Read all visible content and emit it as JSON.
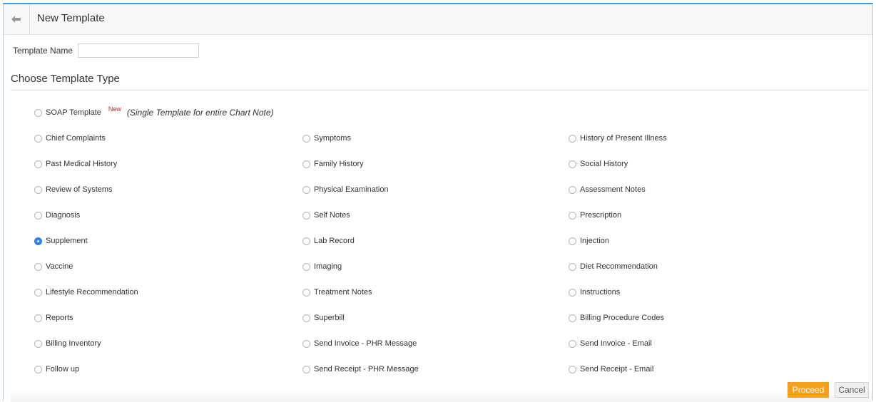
{
  "header": {
    "title": "New Template",
    "back_icon": "arrow-left-icon"
  },
  "template_name": {
    "label": "Template Name",
    "value": "",
    "placeholder": ""
  },
  "section": {
    "title": "Choose Template Type"
  },
  "soap": {
    "label": "SOAP Template",
    "badge": "New",
    "description": "(Single Template for entire Chart Note)",
    "selected": false
  },
  "selected_option": "Supplement",
  "accent_color": "#2f7fe5",
  "rows": [
    [
      "Chief Complaints",
      "Symptoms",
      "History of Present Illness"
    ],
    [
      "Past Medical History",
      "Family History",
      "Social History"
    ],
    [
      "Review of Systems",
      "Physical Examination",
      "Assessment Notes"
    ],
    [
      "Diagnosis",
      "Self Notes",
      "Prescription"
    ],
    [
      "Supplement",
      "Lab Record",
      "Injection"
    ],
    [
      "Vaccine",
      "Imaging",
      "Diet Recommendation"
    ],
    [
      "Lifestyle Recommendation",
      "Treatment Notes",
      "Instructions"
    ],
    [
      "Reports",
      "Superbill",
      "Billing Procedure Codes"
    ],
    [
      "Billing Inventory",
      "Send Invoice - PHR Message",
      "Send Invoice - Email"
    ],
    [
      "Follow up",
      "Send Receipt - PHR Message",
      "Send Receipt - Email"
    ]
  ],
  "buttons": {
    "proceed": "Proceed",
    "cancel": "Cancel",
    "proceed_color": "#f5a01a"
  }
}
